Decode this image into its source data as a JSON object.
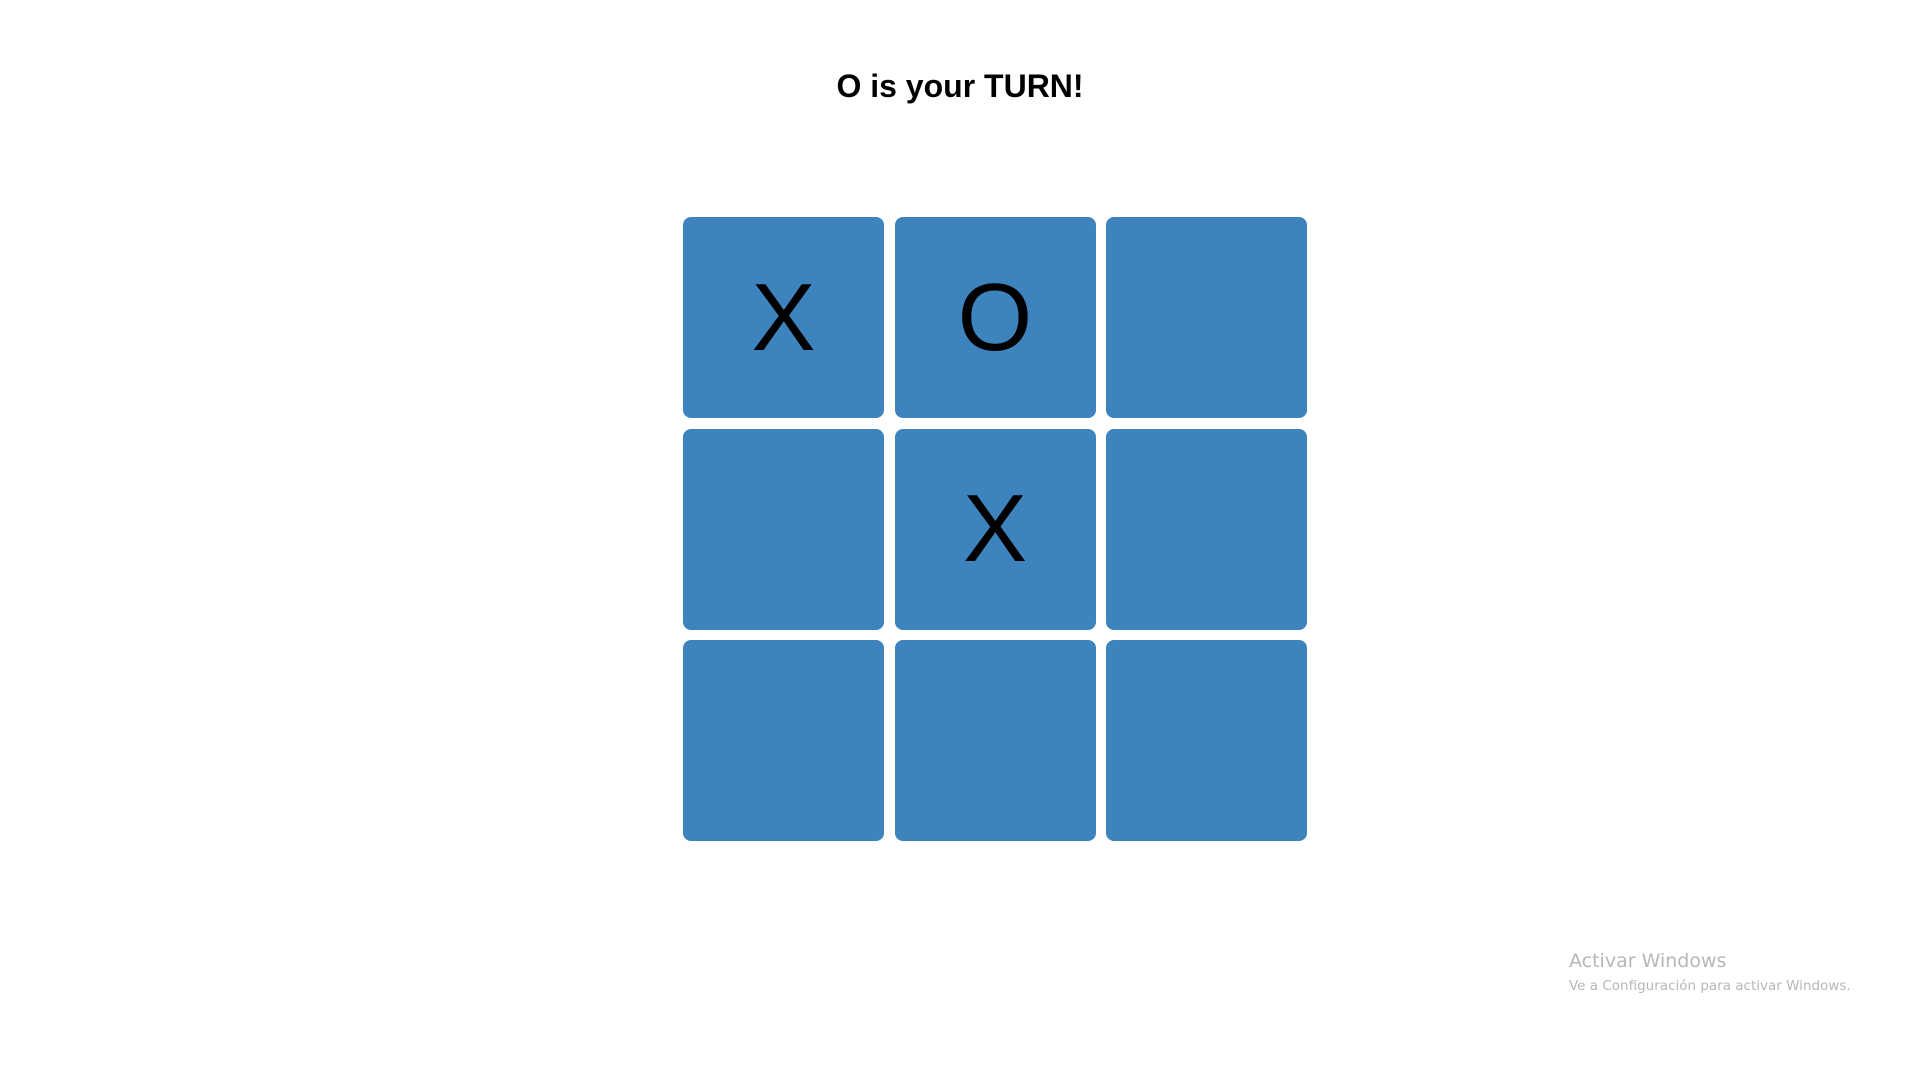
{
  "game": {
    "status": "O is your TURN!",
    "board": [
      [
        "X",
        "O",
        ""
      ],
      [
        "",
        "X",
        ""
      ],
      [
        "",
        "",
        ""
      ]
    ],
    "cell_color": "#3d83be"
  },
  "watermark": {
    "title": "Activar Windows",
    "subtitle": "Ve a Configuración para activar Windows."
  }
}
